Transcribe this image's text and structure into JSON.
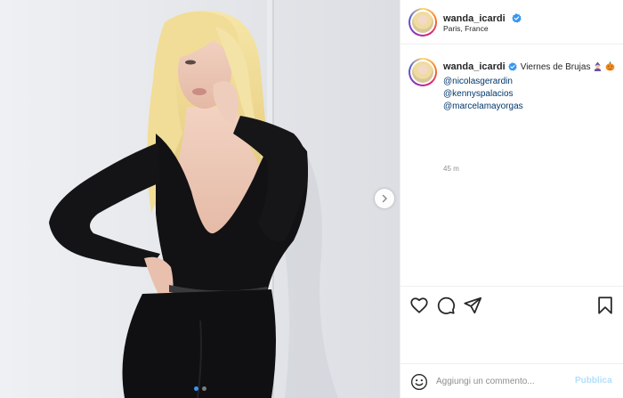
{
  "post": {
    "username": "wanda_icardi",
    "location": "Paris, France",
    "caption": {
      "username": "wanda_icardi",
      "text": "Viernes de Brujas",
      "emojis": [
        "woman-mage-emoji",
        "jack-o-lantern-emoji"
      ],
      "mentions": [
        "@nicolasgerardin",
        "@kennyspalacios",
        "@marcelamayorgas"
      ]
    },
    "time": "45 m"
  },
  "carousel": {
    "slide_count": 2,
    "active_slide": 1
  },
  "comment_box": {
    "placeholder": "Aggiungi un commento...",
    "publish_label": "Pubblica"
  },
  "colors": {
    "link": "#00376b",
    "verified": "#3897f0",
    "publish_disabled": "#b2dffc",
    "dress": "#121214"
  },
  "icons": [
    "heart-icon",
    "comment-icon",
    "share-icon",
    "bookmark-icon",
    "emoji-smile-icon",
    "chevron-right-icon",
    "verified-badge-icon"
  ]
}
